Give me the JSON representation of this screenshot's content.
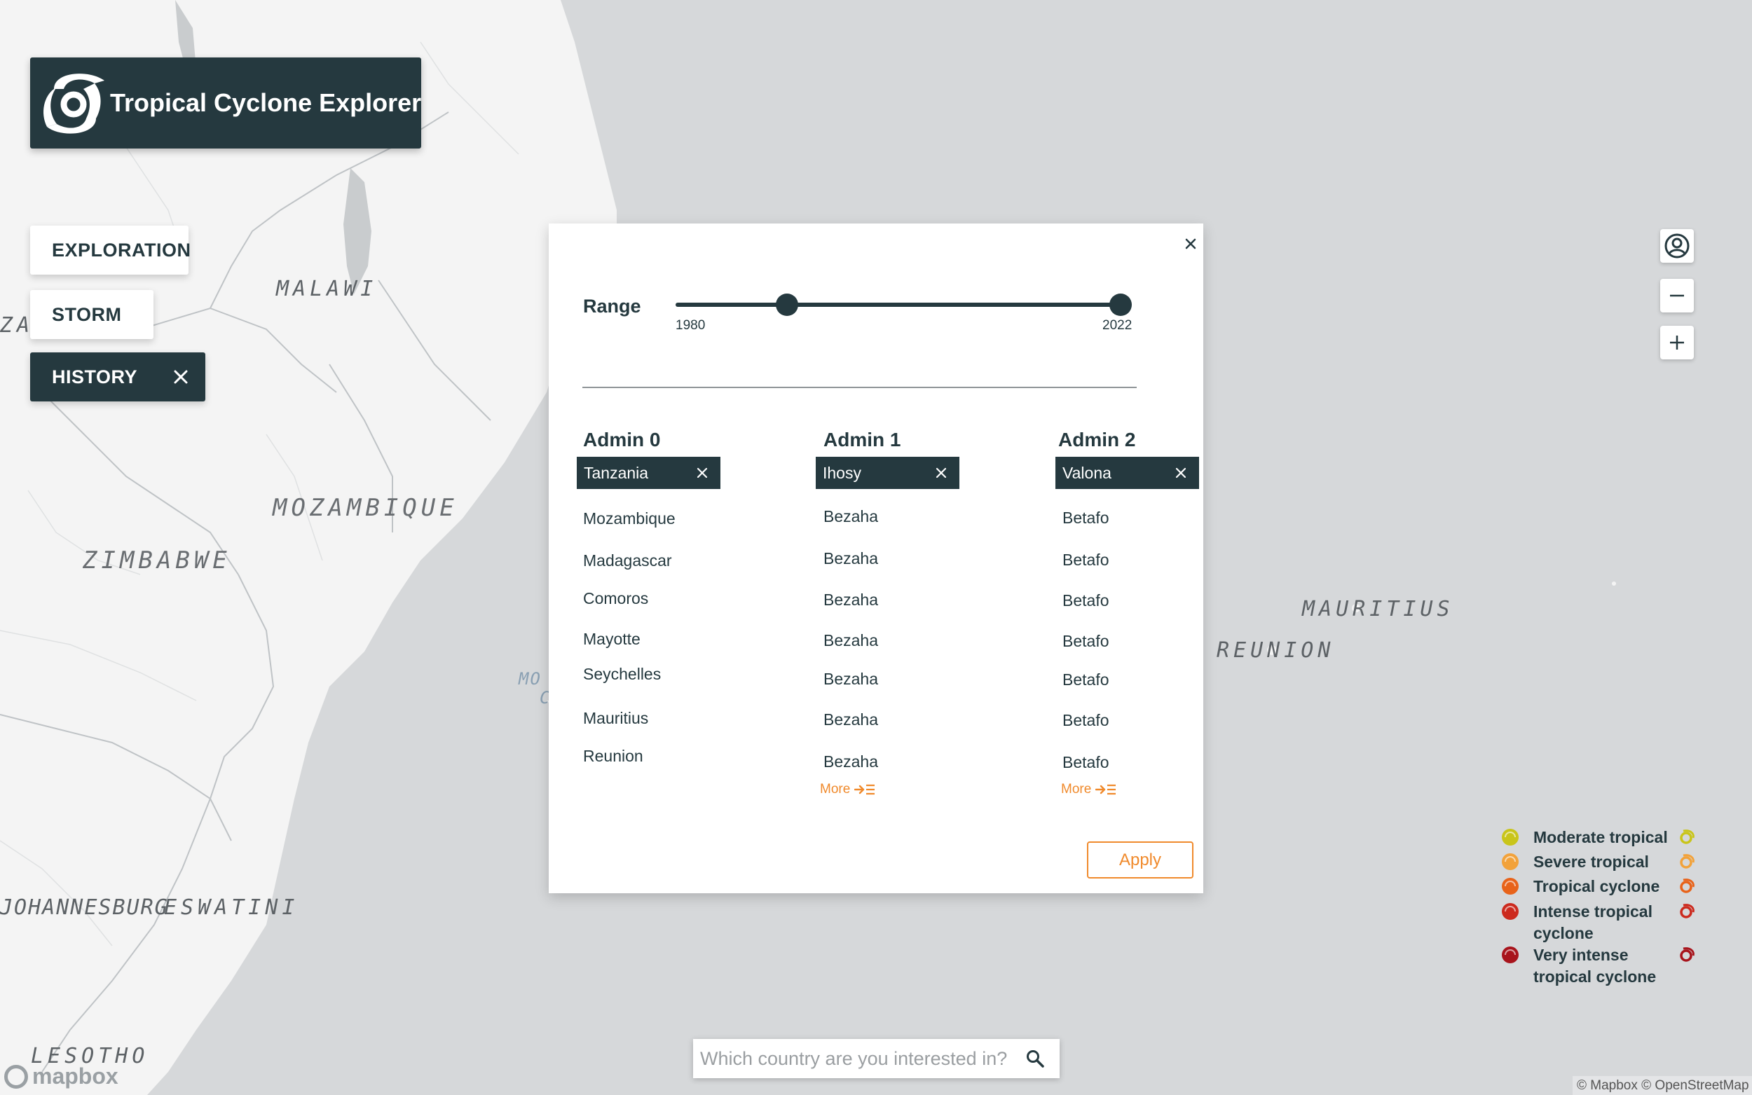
{
  "app": {
    "title": "Tropical Cyclone Explorer"
  },
  "map": {
    "labels": {
      "malawi": "MALAWI",
      "mozambique": "MOZAMBIQUE",
      "zimbabwe": "ZIMBABWE",
      "za": "ZA",
      "mauritius": "MAURITIUS",
      "reunion": "REUNION",
      "johannesburg": "JOHANNESBURG",
      "eswatini": "ESWATINI",
      "lesotho": "LESOTHO",
      "mo": "MO",
      "c": "C"
    },
    "logo_text": "mapbox",
    "attribution": "© Mapbox © OpenStreetMap"
  },
  "nav": {
    "exploration": "EXPLORATION",
    "storm": "STORM",
    "history": "HISTORY",
    "active": "history"
  },
  "filter": {
    "range_label": "Range",
    "range_min_label": "1980",
    "range_max_label": "2022",
    "range_selected_fraction": [
      0.25,
      1.0
    ],
    "columns": [
      {
        "title": "Admin 0",
        "selected": "Tanzania",
        "options": [
          "Mozambique",
          "Madagascar",
          "Comoros",
          "Mayotte",
          "Seychelles",
          "Mauritius",
          "Reunion"
        ]
      },
      {
        "title": "Admin 1",
        "selected": "Ihosy",
        "options": [
          "Bezaha",
          "Bezaha",
          "Bezaha",
          "Bezaha",
          "Bezaha",
          "Bezaha",
          "Bezaha"
        ],
        "more": "More"
      },
      {
        "title": "Admin 2",
        "selected": "Valona",
        "options": [
          "Betafo",
          "Betafo",
          "Betafo",
          "Betafo",
          "Betafo",
          "Betafo",
          "Betafo"
        ],
        "more": "More"
      }
    ],
    "apply_label": "Apply"
  },
  "legend": [
    {
      "label": "Moderate tropical",
      "color": "#c9c51a"
    },
    {
      "label": "Severe tropical",
      "color": "#f2a23a"
    },
    {
      "label": "Tropical cyclone",
      "color": "#e8631a"
    },
    {
      "label": "Intense tropical cyclone",
      "color": "#cc2a1e"
    },
    {
      "label": "Very intense tropical cyclone",
      "color": "#a8141c"
    }
  ],
  "search": {
    "placeholder": "Which country are you interested in?"
  },
  "colors": {
    "primary": "#25393f",
    "accent": "#f08a2c",
    "map_water": "#d6d8da",
    "map_land": "#f4f4f4"
  }
}
